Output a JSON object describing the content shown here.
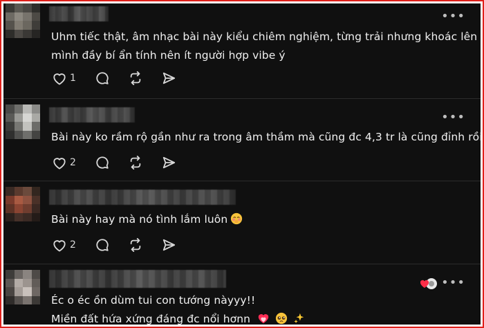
{
  "comments": [
    {
      "text_lines": [
        "Uhm tiếc thật, âm nhạc bài này kiểu chiêm nghiệm, từng trải nhưng khoác lên",
        "mình đầy bí ẩn tính nên ít người hợp vibe ý"
      ],
      "like_count": "1",
      "emojis": []
    },
    {
      "text_lines": [
        "Bài này ko rầm rộ gần như ra trong âm thầm mà cũng đc 4,3 tr là cũng đỉnh rồi"
      ],
      "like_count": "2",
      "emojis": []
    },
    {
      "text_lines": [
        "Bài này hay mà nó tình lắm luôn"
      ],
      "like_count": "2",
      "emojis": [
        "blushing-face-emoji"
      ]
    },
    {
      "text_lines": [
        "Éc o éc ồn dùm tui con tướng nàyyy!!",
        "Miền đất hứa xứng đáng đc nổi hơnn"
      ],
      "like_count": "",
      "emojis": [
        "heart-on-fire-emoji",
        "pleading-face-emoji",
        "sparkles-emoji"
      ]
    }
  ],
  "more_label": "•••",
  "colors": {
    "frame_border": "#e0201b",
    "background": "#101010",
    "text": "#f1f1f1",
    "icon": "#d8d8d8",
    "separator": "#2c2c2c"
  }
}
